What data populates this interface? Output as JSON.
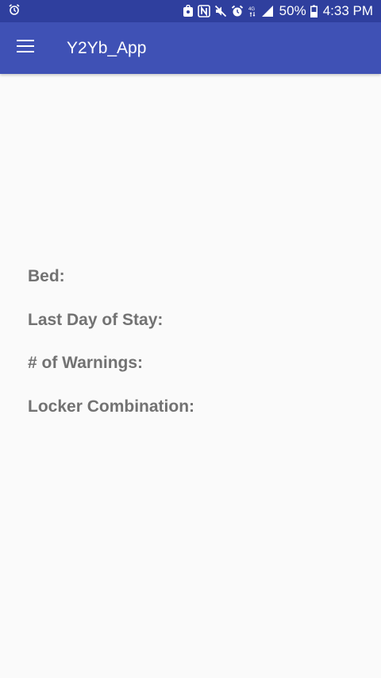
{
  "status_bar": {
    "left_icons": [
      "alarm-icon"
    ],
    "right_icons": [
      "sim-lock-icon",
      "nfc-icon",
      "mute-icon",
      "alarm-icon",
      "lte-icon",
      "signal-icon",
      "battery-icon"
    ],
    "battery": "50%",
    "time": "4:33 PM"
  },
  "app_bar": {
    "menu_icon": "hamburger-menu-icon",
    "title": "Y2Yb_App"
  },
  "info": {
    "labels": [
      "Bed:",
      "Last Day of Stay:",
      "# of Warnings:",
      "Locker Combination:"
    ]
  },
  "colors": {
    "status_bar": "#2f3f9e",
    "app_bar": "#3f51b5",
    "background": "#fafafa",
    "label_text": "#727272"
  }
}
